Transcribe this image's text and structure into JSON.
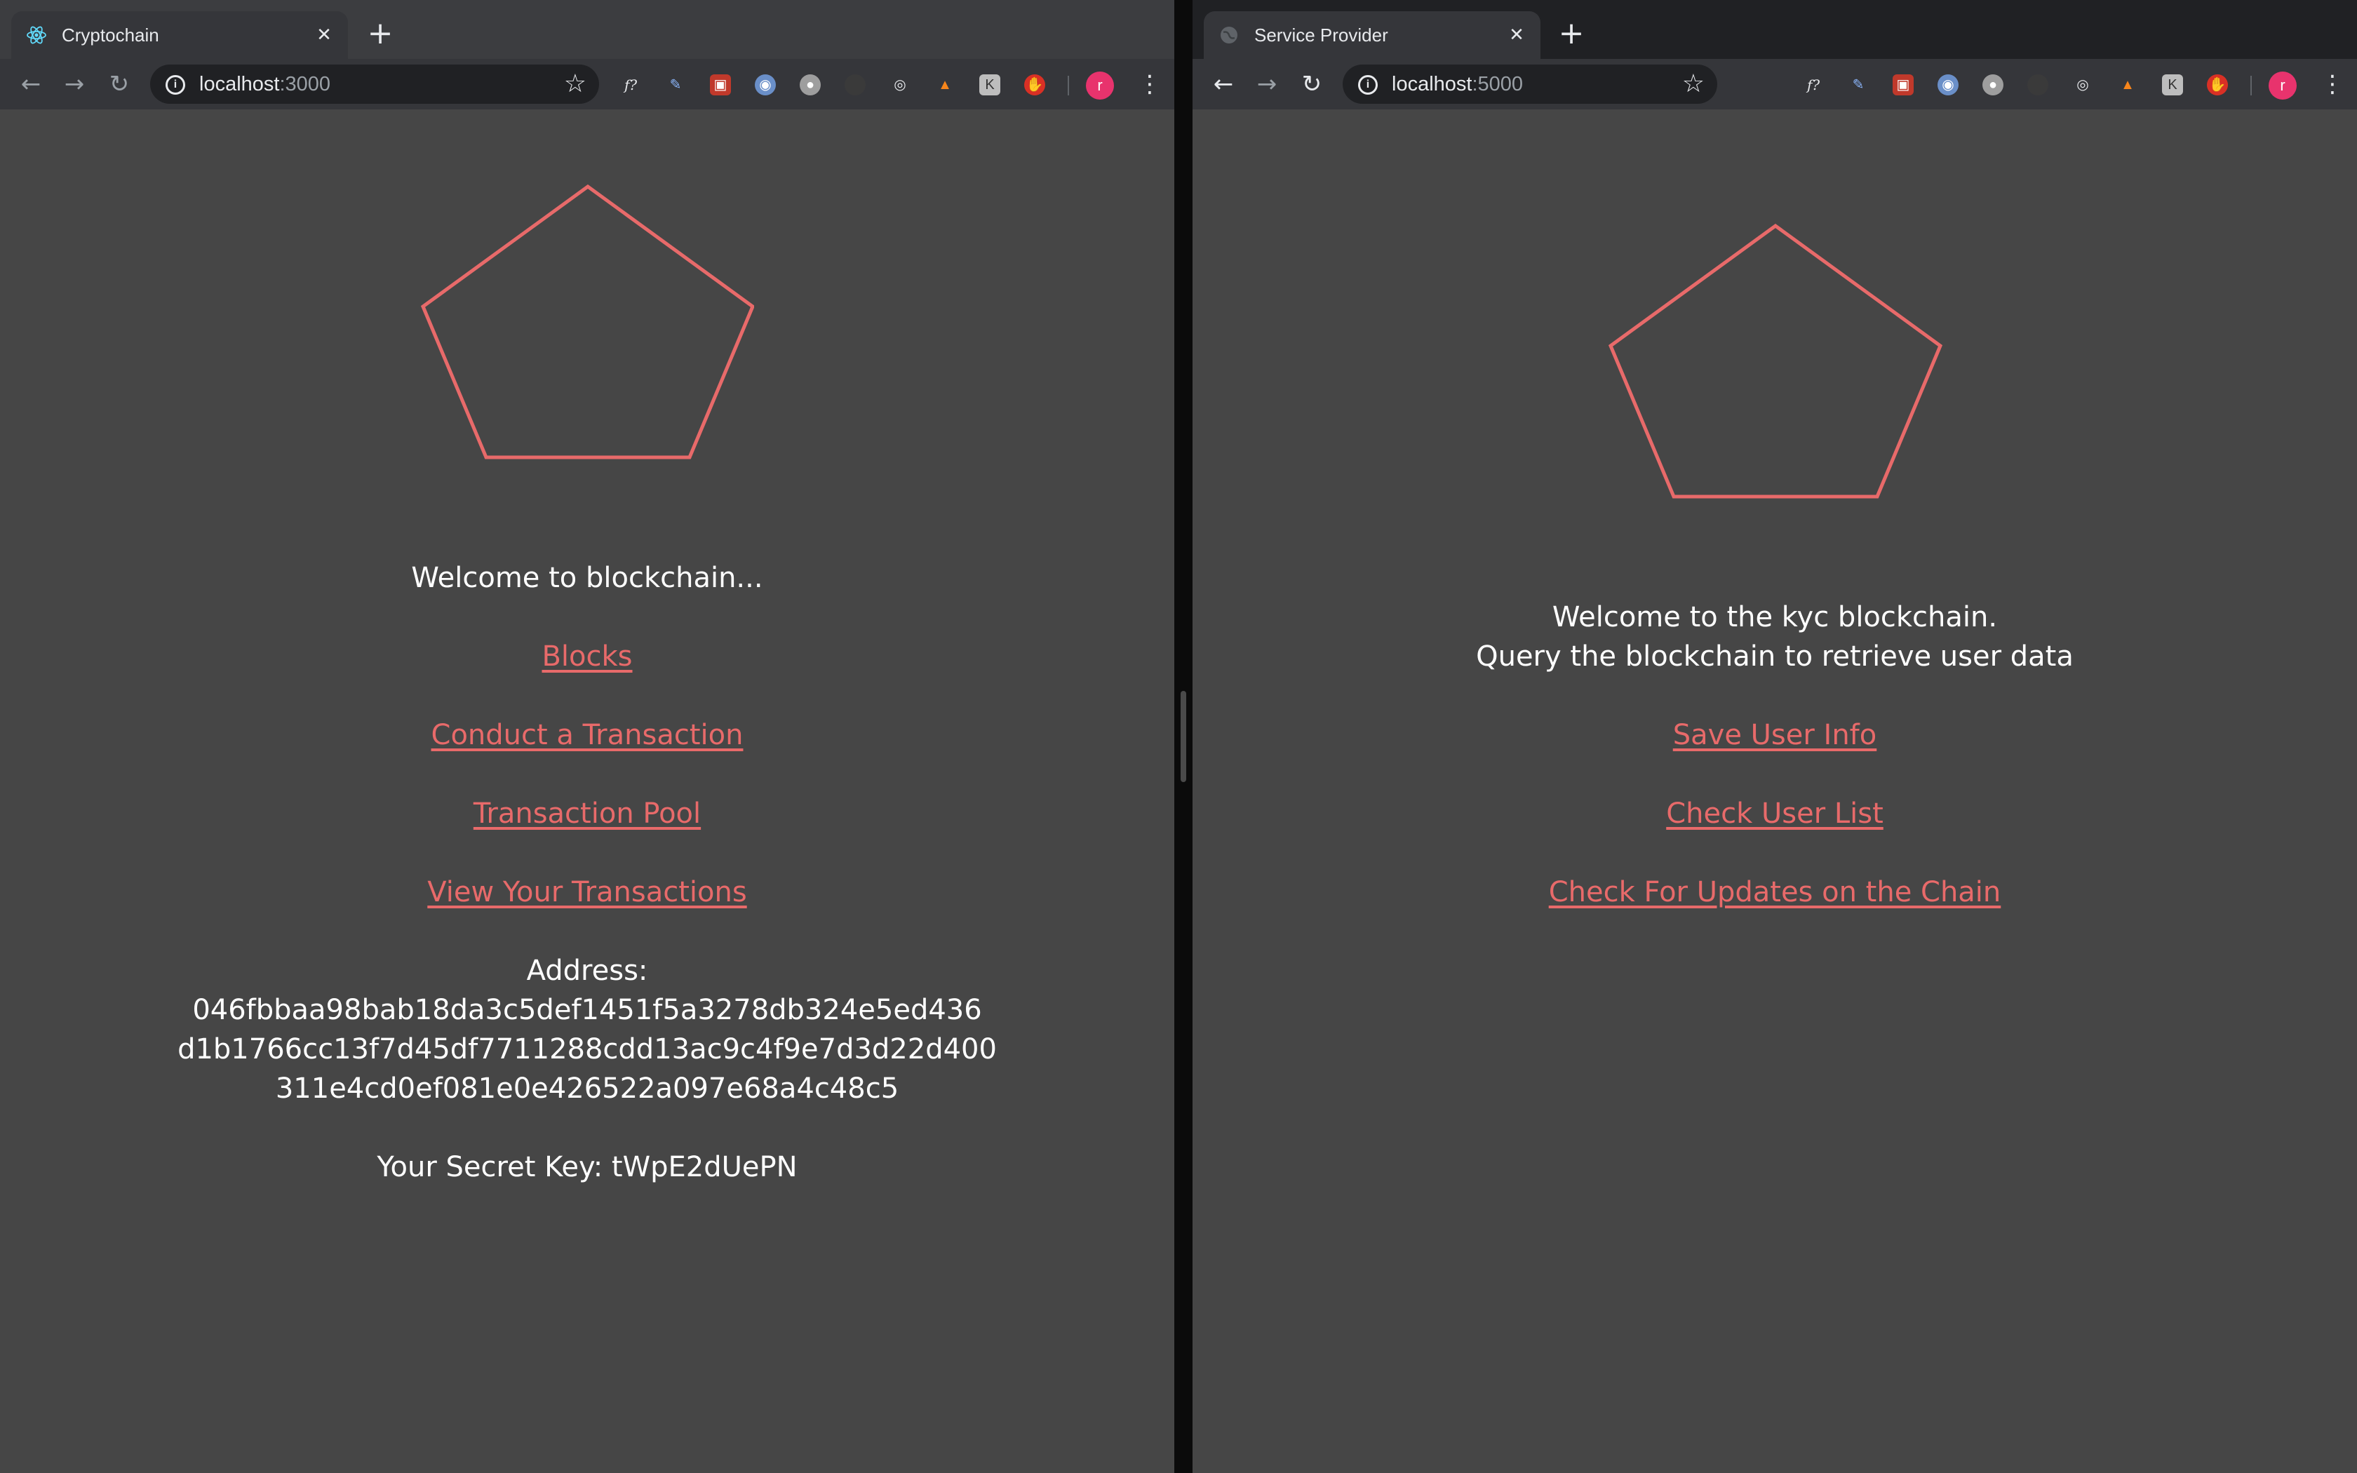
{
  "left_window": {
    "tab_title": "Cryptochain",
    "url_host": "localhost",
    "url_port": ":3000",
    "welcome": "Welcome to blockchain...",
    "links": [
      "Blocks",
      "Conduct a Transaction",
      "Transaction Pool",
      "View Your Transactions"
    ],
    "address_label": "Address:",
    "address_lines": [
      "046fbbaa98bab18da3c5def1451f5a3278db324e5ed436",
      "d1b1766cc13f7d45df7711288cdd13ac9c4f9e7d3d22d400",
      "311e4cd0ef081e0e426522a097e68a4c48c5"
    ],
    "secret_key": "Your Secret Key: tWpE2dUePN"
  },
  "right_window": {
    "tab_title": "Service Provider",
    "url_host": "localhost",
    "url_port": ":5000",
    "welcome_line1": "Welcome to the kyc blockchain.",
    "welcome_line2": "Query the blockchain to retrieve user data",
    "links": [
      "Save User Info",
      "Check User List",
      "Check For Updates on the Chain"
    ]
  },
  "browser": {
    "close_glyph": "✕",
    "new_tab_glyph": "+",
    "avatar_letter": "r",
    "extension_icons": [
      "function-icon",
      "pen-icon",
      "red-square-icon",
      "blue-circle-icon",
      "gray-circle-icon",
      "dark-icon",
      "target-icon",
      "metamask-icon",
      "k-icon",
      "stop-hand-icon"
    ]
  },
  "colors": {
    "accent": "#e86a6a",
    "background": "#464646",
    "text": "#ffffff"
  }
}
